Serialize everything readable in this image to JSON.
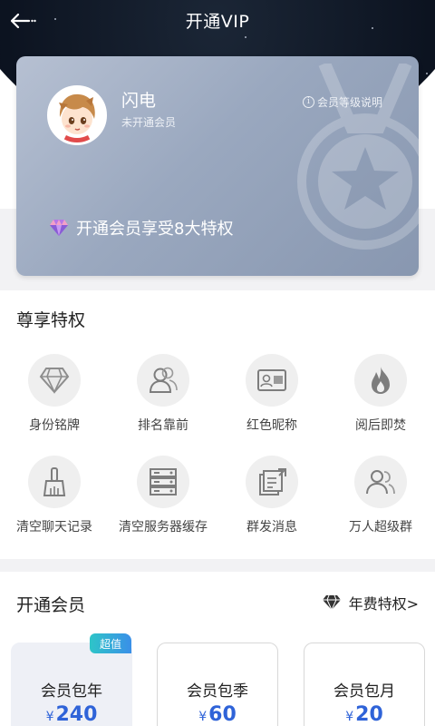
{
  "header": {
    "title": "开通VIP",
    "back_icon": "back-arrow-icon"
  },
  "vip_card": {
    "username": "闪电",
    "member_status": "未开通会员",
    "level_info_label": "会员等级说明",
    "promo_text": "开通会员享受8大特权",
    "colors": {
      "card": "#9aa8bf"
    }
  },
  "privileges": {
    "title": "尊享特权",
    "items": [
      {
        "label": "身份铭牌",
        "icon": "diamond-badge-icon"
      },
      {
        "label": "排名靠前",
        "icon": "ranking-users-icon"
      },
      {
        "label": "红色昵称",
        "icon": "id-card-icon"
      },
      {
        "label": "阅后即焚",
        "icon": "flame-icon"
      },
      {
        "label": "清空聊天记录",
        "icon": "broom-icon"
      },
      {
        "label": "清空服务器缓存",
        "icon": "server-icon"
      },
      {
        "label": "群发消息",
        "icon": "broadcast-message-icon"
      },
      {
        "label": "万人超级群",
        "icon": "group-users-icon"
      }
    ]
  },
  "membership": {
    "title": "开通会员",
    "annual_link": "年费特权>",
    "currency_symbol": "¥",
    "accent_color": "#2f63d8",
    "plans": [
      {
        "name": "会员包年",
        "price": "240",
        "badge": "超值",
        "selected": true
      },
      {
        "name": "会员包季",
        "price": "60",
        "badge": "",
        "selected": false
      },
      {
        "name": "会员包月",
        "price": "20",
        "badge": "",
        "selected": false
      }
    ]
  }
}
